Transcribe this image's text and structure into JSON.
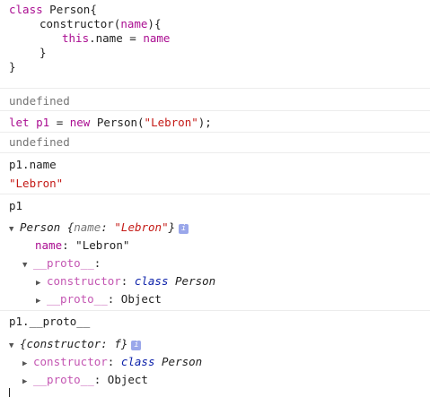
{
  "console": {
    "code": {
      "l1_kw": "class",
      "l1_name": "Person",
      "l1_brace": "{",
      "l2_ctor": "constructor(",
      "l2_param": "name",
      "l2_end": "){",
      "l3_this": "this",
      "l3_prop": ".name",
      "l3_eq": " = ",
      "l3_val": "name",
      "l4": "}",
      "l5": "}"
    },
    "undefined_1": "undefined",
    "let_line": {
      "kw": "let",
      "var": "p1",
      "eq": " = ",
      "new": "new",
      "call": " Person(",
      "arg": "\"Lebron\"",
      "end": ");"
    },
    "undefined_2": "undefined",
    "p1_name_input": "p1.name",
    "p1_name_output": "\"Lebron\"",
    "p1_input": "p1",
    "p1_object": {
      "summary_cls": "Person ",
      "summary_open": "{",
      "summary_key": "name",
      "summary_colon": ": ",
      "summary_val": "\"Lebron\"",
      "summary_close": "}",
      "info": "i",
      "name_key": "name",
      "name_colon": ": ",
      "name_val": "\"Lebron\"",
      "proto_key": "__proto__",
      "proto_colon": ":",
      "ctor_key": "constructor",
      "ctor_colon": ": ",
      "ctor_kw": "class",
      "ctor_val": " Person",
      "proto2_key": "__proto__",
      "proto2_colon": ": ",
      "proto2_val": "Object"
    },
    "proto_input": "p1.__proto__",
    "proto_object": {
      "summary": "{constructor: f}",
      "info": "i",
      "ctor_key": "constructor",
      "ctor_colon": ": ",
      "ctor_kw": "class",
      "ctor_val": " Person",
      "proto_key": "__proto__",
      "proto_colon": ": ",
      "proto_val": "Object"
    },
    "triangles": {
      "expanded": "▼",
      "collapsed": "▶"
    }
  }
}
